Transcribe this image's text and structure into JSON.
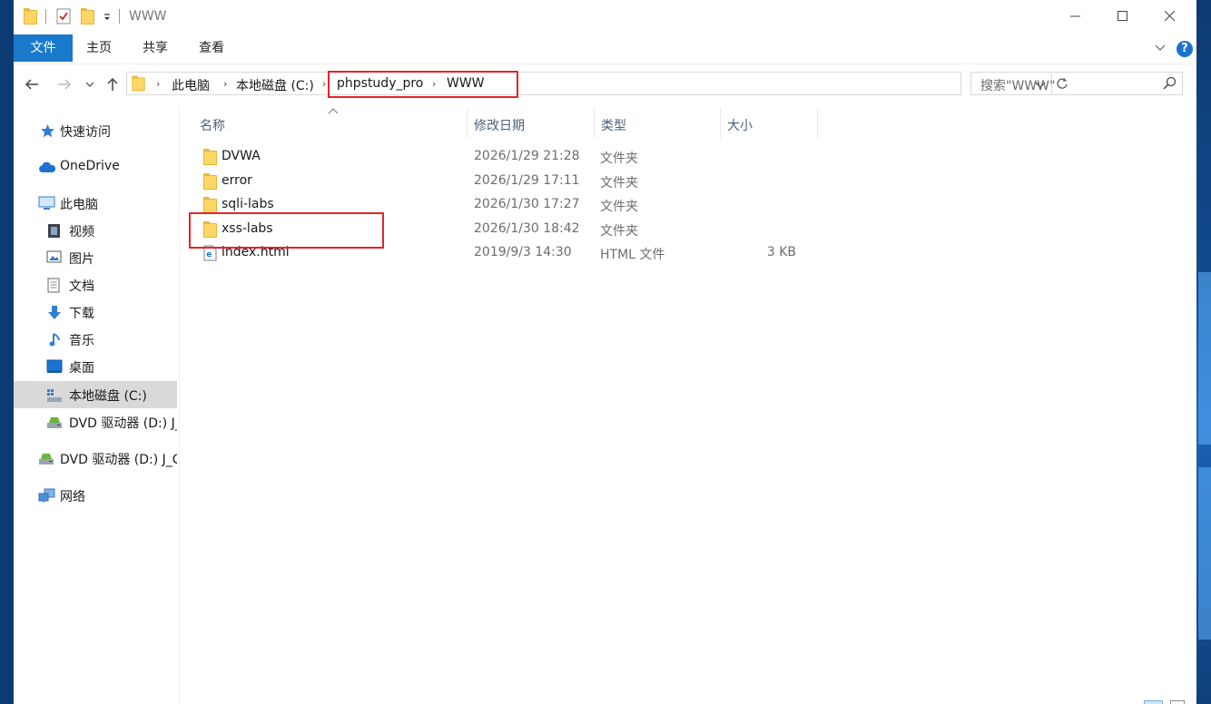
{
  "window": {
    "title": "WWW"
  },
  "ribbon": {
    "tabs": [
      "文件",
      "主页",
      "共享",
      "查看"
    ]
  },
  "address": {
    "crumbs": [
      "此电脑",
      "本地磁盘 (C:)",
      "phpstudy_pro",
      "WWW"
    ]
  },
  "search": {
    "placeholder": "搜索\"WWW\""
  },
  "sidebar": {
    "items": [
      {
        "label": "快速访问",
        "icon": "star-icon"
      },
      {
        "label": "OneDrive",
        "icon": "cloud-icon"
      },
      {
        "label": "此电脑",
        "icon": "computer-icon"
      },
      {
        "label": "视频",
        "icon": "video-icon"
      },
      {
        "label": "图片",
        "icon": "pictures-icon"
      },
      {
        "label": "文档",
        "icon": "documents-icon"
      },
      {
        "label": "下载",
        "icon": "download-icon"
      },
      {
        "label": "音乐",
        "icon": "music-icon"
      },
      {
        "label": "桌面",
        "icon": "desktop-icon"
      },
      {
        "label": "本地磁盘 (C:)",
        "icon": "drive-icon",
        "selected": true
      },
      {
        "label": "DVD 驱动器 (D:) J_",
        "icon": "dvd-icon"
      },
      {
        "label": "DVD 驱动器 (D:) J_C",
        "icon": "dvd-icon"
      },
      {
        "label": "网络",
        "icon": "network-icon"
      }
    ]
  },
  "columns": {
    "name": "名称",
    "date": "修改日期",
    "type": "类型",
    "size": "大小"
  },
  "files": [
    {
      "name": "DVWA",
      "date": "2026/1/29 21:28",
      "type": "文件夹",
      "size": ""
    },
    {
      "name": "error",
      "date": "2026/1/29 17:11",
      "type": "文件夹",
      "size": ""
    },
    {
      "name": "sqli-labs",
      "date": "2026/1/30 17:27",
      "type": "文件夹",
      "size": ""
    },
    {
      "name": "xss-labs",
      "date": "2026/1/30 18:42",
      "type": "文件夹",
      "size": ""
    },
    {
      "name": "index.html",
      "date": "2019/9/3 14:30",
      "type": "HTML 文件",
      "size": "3 KB"
    }
  ],
  "colors": {
    "accent": "#1979ca",
    "highlight": "#e3242b",
    "folder": "#ffd664",
    "selected": "#d9d9d9"
  }
}
